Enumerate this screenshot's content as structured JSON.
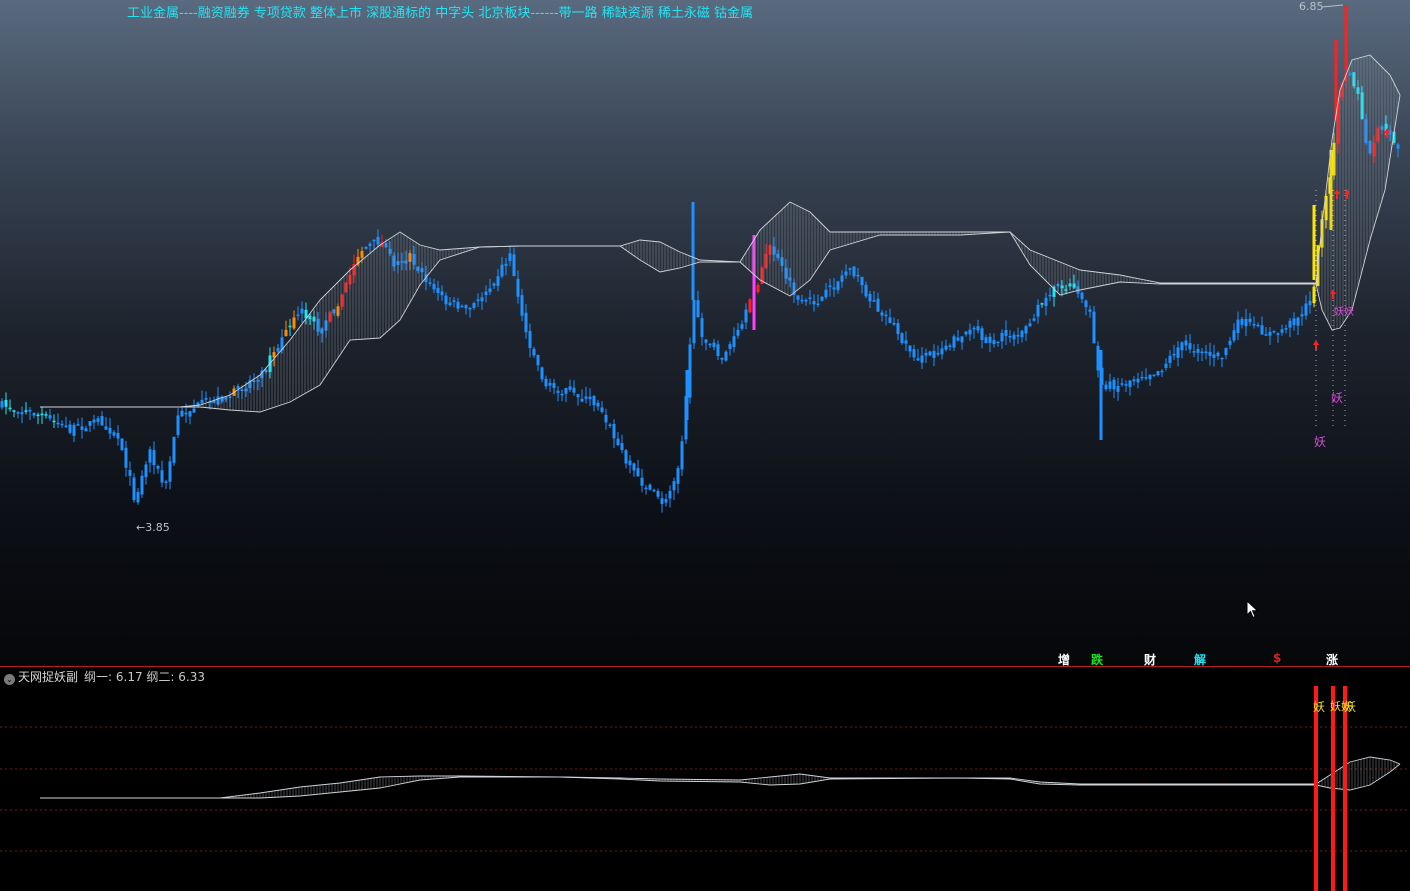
{
  "header": {
    "sectors_text": "工业金属----融资融券 专项贷款 整体上市 深股通标的 中字头 北京板块------带一路 稀缺资源 稀土永磁 钴金属"
  },
  "price_labels": {
    "high": "6.85",
    "low": "←3.85"
  },
  "tags": [
    {
      "text": "增",
      "color": "#ffffff"
    },
    {
      "text": "跌",
      "color": "#19e619"
    },
    {
      "text": "财",
      "color": "#ffffff"
    },
    {
      "text": "解",
      "color": "#22e4f4"
    },
    {
      "text": "$",
      "color": "#e02020"
    },
    {
      "text": "涨",
      "color": "#ffffff"
    }
  ],
  "sub_panel": {
    "indicator_name": "天网捉妖副",
    "values_text": "纲一: 6.17  纲二: 6.33",
    "toggle_icon": "⌄"
  },
  "signals": {
    "main": [
      "妖",
      "妖",
      "妖妖"
    ],
    "sub": [
      "妖",
      "妖妖",
      "妖"
    ]
  },
  "colors": {
    "headline": "#22e4f4",
    "candle_down": "#1e90ff",
    "candle_up": "#ff2020",
    "candle_cyan": "#22e4f4",
    "candle_orange": "#ff8c00",
    "candle_yellow": "#ffe600",
    "divider": "#b41e1e",
    "signal_magenta": "#d84ad8",
    "grid_dotted": "#7a1a1a"
  },
  "icons": [
    "chevron-down-icon",
    "mouse-pointer-icon",
    "up-arrow-icon"
  ]
}
